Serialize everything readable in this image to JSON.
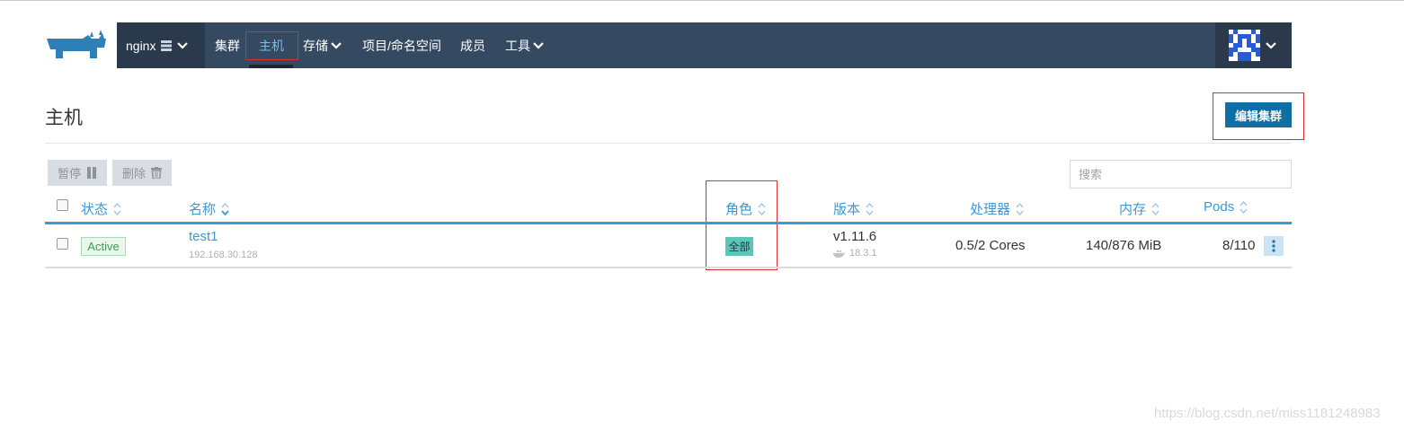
{
  "navbar": {
    "cluster_name": "nginx",
    "items": [
      {
        "label": "集群"
      },
      {
        "label": "主机"
      },
      {
        "label": "存储"
      },
      {
        "label": "项目/命名空间"
      },
      {
        "label": "成员"
      },
      {
        "label": "工具"
      }
    ],
    "active_item": "主机"
  },
  "page": {
    "title": "主机",
    "edit_cluster_button": "编辑集群"
  },
  "toolbar": {
    "pause_label": "暂停",
    "delete_label": "删除",
    "search_placeholder": "搜索"
  },
  "table": {
    "headers": {
      "state": "状态",
      "name": "名称",
      "role": "角色",
      "version": "版本",
      "cpu": "处理器",
      "memory": "内存",
      "pods": "Pods"
    },
    "rows": [
      {
        "state": "Active",
        "name": "test1",
        "ip": "192.168.30.128",
        "role": "全部",
        "version": "v1.11.6",
        "docker_version": "18.3.1",
        "cpu": "0.5/2 Cores",
        "memory": "140/876 MiB",
        "pods": "8/110"
      }
    ]
  },
  "watermark": "https://blog.csdn.net/miss1181248983",
  "colors": {
    "navbar": "#354a61",
    "navbar_dark": "#2a3a4c",
    "accent": "#3d98d3",
    "primary_button": "#0f6fa4",
    "active_green": "#3c9c52",
    "role_teal": "#5cc5bb",
    "highlight_red": "#e12b2b"
  }
}
